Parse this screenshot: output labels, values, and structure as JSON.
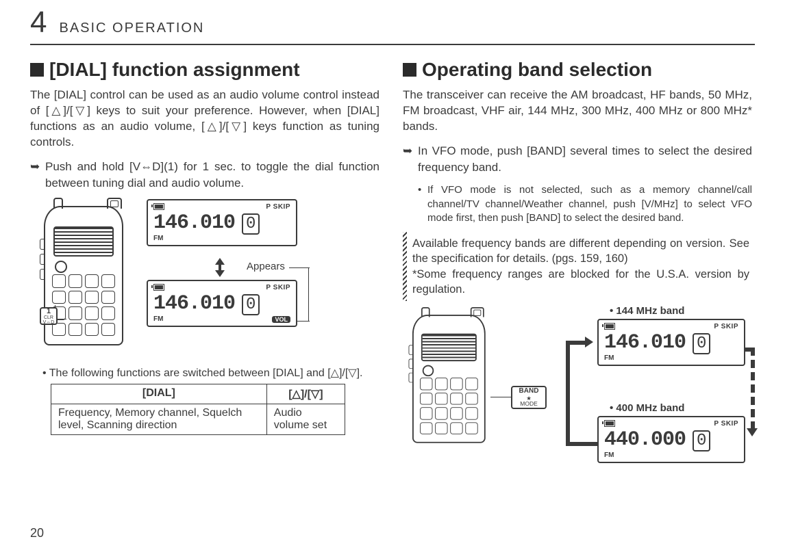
{
  "chapter": {
    "number": "4",
    "title": "BASIC OPERATION"
  },
  "page_number": "20",
  "left": {
    "heading": "[DIAL] function assignment",
    "para": "The [DIAL] control can be used as an audio volume control instead of [△]/[▽] keys to suit your preference. However, when [DIAL] functions as an audio volume, [△]/[▽] keys function as tuning controls.",
    "bullet": "Push and hold [V⇔D](1) for 1 sec. to toggle the dial function between tuning dial and audio volume.",
    "key_callout": {
      "num": "1",
      "top": "CLR",
      "bot": "V⇔D"
    },
    "lcd1": {
      "pskip": "P SKIP",
      "freq": "146.010",
      "ch": "0",
      "mode": "FM"
    },
    "lcd2": {
      "pskip": "P SKIP",
      "freq": "146.010",
      "ch": "0",
      "mode": "FM",
      "vol": "VOL"
    },
    "appears_label": "Appears",
    "switch_note": "The following functions are switched between [DIAL] and [△]/[▽].",
    "table": {
      "headers": [
        "[DIAL]",
        "[△]/[▽]"
      ],
      "row": [
        "Frequency, Memory channel, Squelch level, Scanning direction",
        "Audio volume set"
      ]
    }
  },
  "right": {
    "heading": "Operating band selection",
    "para": "The transceiver can receive the AM broadcast, HF bands, 50 MHz, FM broadcast, VHF air, 144 MHz, 300 MHz, 400 MHz or 800 MHz* bands.",
    "bullet": "In VFO mode, push [BAND] several times to select the desired frequency band.",
    "subnote": "If VFO mode is not selected, such as a memory channel/call channel/TV channel/Weather channel, push [V/MHz] to select VFO mode first, then push [BAND] to select the desired band.",
    "hatch1": "Available frequency bands are different depending on version. See the specification for details. (pgs. 159, 160)",
    "hatch2": "*Some frequency ranges are blocked for the U.S.A. version by regulation.",
    "band_btn": {
      "top": "BAND",
      "mid": "★",
      "bot": "MODE"
    },
    "band144_label": "• 144 MHz band",
    "band400_label": "• 400 MHz band",
    "lcd_144": {
      "pskip": "P SKIP",
      "freq": "146.010",
      "ch": "0",
      "mode": "FM"
    },
    "lcd_400": {
      "pskip": "P SKIP",
      "freq": "440.000",
      "ch": "0",
      "mode": "FM"
    }
  }
}
